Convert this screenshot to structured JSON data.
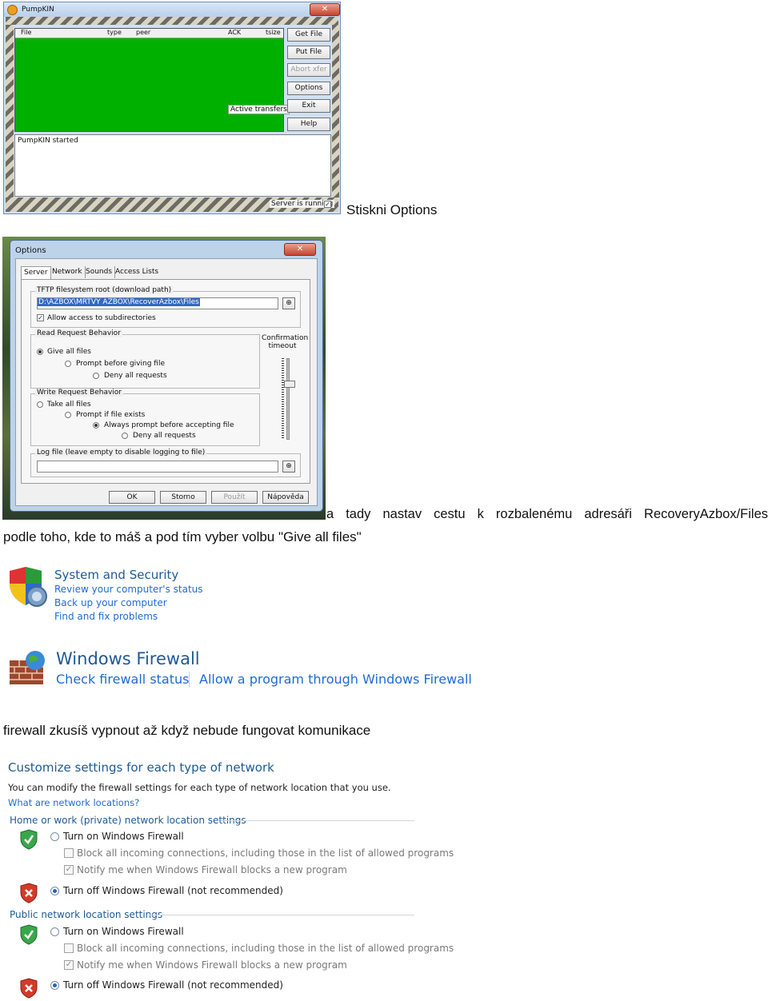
{
  "pumpkin": {
    "title": "PumpKIN",
    "columns": [
      "File",
      "type",
      "peer",
      "ACK",
      "tsize"
    ],
    "buttons": [
      {
        "label": "Get File",
        "enabled": true
      },
      {
        "label": "Put File",
        "enabled": true
      },
      {
        "label": "Abort xfer",
        "enabled": false
      },
      {
        "label": "Options",
        "enabled": true
      },
      {
        "label": "Exit",
        "enabled": true
      },
      {
        "label": "Help",
        "enabled": true
      }
    ],
    "active_transfers": "Active transfers",
    "log": "PumpKIN started",
    "server_status": "Server is running",
    "server_checked": true
  },
  "caption1": "Stiskni Options",
  "options": {
    "title": "Options",
    "tabs": [
      "Server",
      "Network",
      "Sounds",
      "Access Lists"
    ],
    "root_group": "TFTP filesystem root (download path)",
    "root_path": "D:\\AZBOX\\MRTVY AZBOX\\RecoverAzbox\\Files",
    "allow_subdirs": "Allow access to subdirectories",
    "read_group": "Read Request Behavior",
    "read_options": [
      "Give all files",
      "Prompt before giving file",
      "Deny all requests"
    ],
    "read_selected": 0,
    "confirmation": "Confirmation timeout",
    "write_group": "Write Request Behavior",
    "write_options": [
      "Take all files",
      "Prompt if file exists",
      "Always prompt before accepting file",
      "Deny all requests"
    ],
    "write_selected": 2,
    "log_group": "Log file (leave empty to disable logging to file)",
    "log_value": "",
    "buttons": [
      "OK",
      "Storno",
      "Použít",
      "Nápověda"
    ]
  },
  "caption2_line1": "a tady nastav cestu k rozbalenému adresáři RecoveryAzbox/Files",
  "caption2_line2": "podle toho, kde to máš a pod tím vyber volbu \"Give all files\"",
  "system_security": {
    "title": "System and Security",
    "links": [
      "Review your computer's status",
      "Back up your computer",
      "Find and fix problems"
    ]
  },
  "windows_firewall": {
    "title": "Windows Firewall",
    "links": [
      "Check firewall status",
      "Allow a program through Windows Firewall"
    ]
  },
  "caption3": "firewall zkusíš vypnout až když nebude fungovat komunikace",
  "firewall_settings": {
    "heading": "Customize settings for each type of network",
    "description": "You can modify the firewall settings for each type of network location that you use.",
    "link": "What are network locations?",
    "sections": [
      {
        "title": "Home or work (private) network location settings",
        "turn_on": "Turn on Windows Firewall",
        "block_all": "Block all incoming connections, including those in the list of allowed programs",
        "notify": "Notify me when Windows Firewall blocks a new program",
        "turn_off": "Turn off Windows Firewall (not recommended)",
        "selected": "off"
      },
      {
        "title": "Public network location settings",
        "turn_on": "Turn on Windows Firewall",
        "block_all": "Block all incoming connections, including those in the list of allowed programs",
        "notify": "Notify me when Windows Firewall blocks a new program",
        "turn_off": "Turn off Windows Firewall (not recommended)",
        "selected": "off"
      }
    ]
  }
}
